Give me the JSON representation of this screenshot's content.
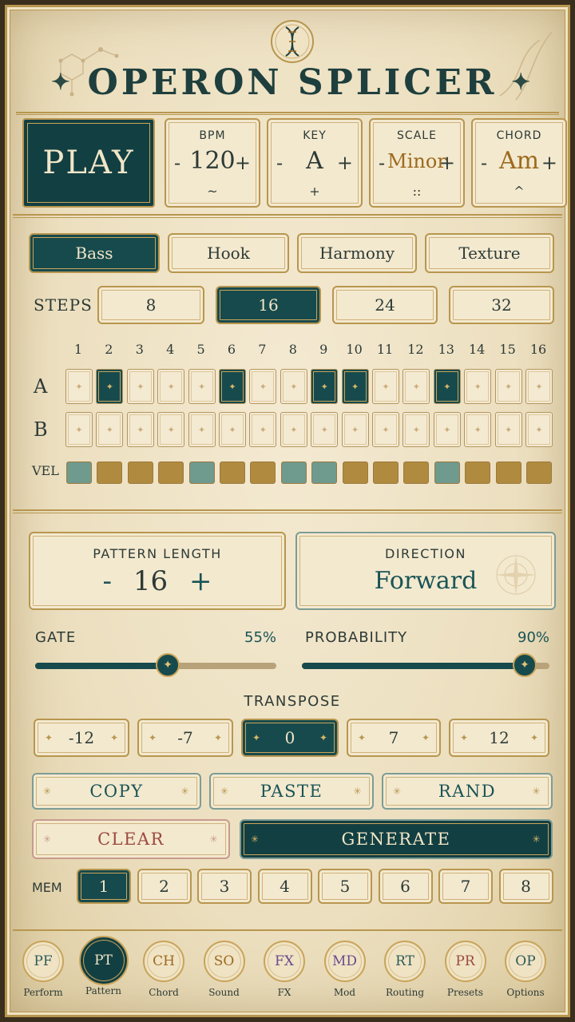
{
  "app": {
    "title": "OPERON SPLICER"
  },
  "header": {
    "play_label": "PLAY",
    "params": [
      {
        "id": "bpm",
        "label": "BPM",
        "value": "120",
        "minus": "-",
        "plus": "+",
        "sub": "~"
      },
      {
        "id": "key",
        "label": "KEY",
        "value": "A",
        "minus": "-",
        "plus": "+",
        "sub": "+"
      },
      {
        "id": "scale",
        "label": "SCALE",
        "value": "Minor",
        "minus": "-",
        "plus": "+",
        "sub": "::"
      },
      {
        "id": "chord",
        "label": "CHORD",
        "value": "Am",
        "minus": "-",
        "plus": "+",
        "sub": "^"
      }
    ]
  },
  "tabs": [
    {
      "label": "Bass",
      "selected": true
    },
    {
      "label": "Hook",
      "selected": false
    },
    {
      "label": "Harmony",
      "selected": false
    },
    {
      "label": "Texture",
      "selected": false
    }
  ],
  "steps": {
    "label": "STEPS",
    "options": [
      "8",
      "16",
      "24",
      "32"
    ],
    "selected": "16"
  },
  "grid": {
    "columns": [
      "1",
      "2",
      "3",
      "4",
      "5",
      "6",
      "7",
      "8",
      "9",
      "10",
      "11",
      "12",
      "13",
      "14",
      "15",
      "16"
    ],
    "rows": [
      {
        "label": "A",
        "active": [
          2,
          6,
          9,
          10,
          13
        ]
      },
      {
        "label": "B",
        "active": []
      }
    ],
    "vel_label": "VEL",
    "velocity": [
      "t",
      "b",
      "b",
      "b",
      "t",
      "b",
      "b",
      "t",
      "t",
      "b",
      "b",
      "b",
      "t",
      "b",
      "b",
      "b"
    ]
  },
  "pattern_length": {
    "label": "PATTERN LENGTH",
    "minus": "-",
    "value": "16",
    "plus": "+"
  },
  "direction": {
    "label": "DIRECTION",
    "value": "Forward"
  },
  "gate": {
    "label": "GATE",
    "value_text": "55%",
    "value": 0.55
  },
  "probability": {
    "label": "PROBABILITY",
    "value_text": "90%",
    "value": 0.9
  },
  "transpose": {
    "label": "TRANSPOSE",
    "options": [
      "-12",
      "-7",
      "0",
      "7",
      "12"
    ],
    "selected": "0"
  },
  "actions": {
    "copy": "COPY",
    "paste": "PASTE",
    "rand": "RAND",
    "clear": "CLEAR",
    "generate": "GENERATE"
  },
  "memory": {
    "label": "MEM",
    "slots": [
      "1",
      "2",
      "3",
      "4",
      "5",
      "6",
      "7",
      "8"
    ],
    "selected": "1"
  },
  "nav": [
    {
      "abbr": "PF",
      "label": "Perform",
      "color": "#2f5b57"
    },
    {
      "abbr": "PT",
      "label": "Pattern",
      "color": "#f1e6c8",
      "selected": true
    },
    {
      "abbr": "CH",
      "label": "Chord",
      "color": "#9c6a1e"
    },
    {
      "abbr": "SO",
      "label": "Sound",
      "color": "#9c6a1e"
    },
    {
      "abbr": "FX",
      "label": "FX",
      "color": "#6a4a8a"
    },
    {
      "abbr": "MD",
      "label": "Mod",
      "color": "#6a4a8a"
    },
    {
      "abbr": "RT",
      "label": "Routing",
      "color": "#2f5b57"
    },
    {
      "abbr": "PR",
      "label": "Presets",
      "color": "#9b4a3f"
    },
    {
      "abbr": "OP",
      "label": "Options",
      "color": "#2f5b57"
    }
  ]
}
